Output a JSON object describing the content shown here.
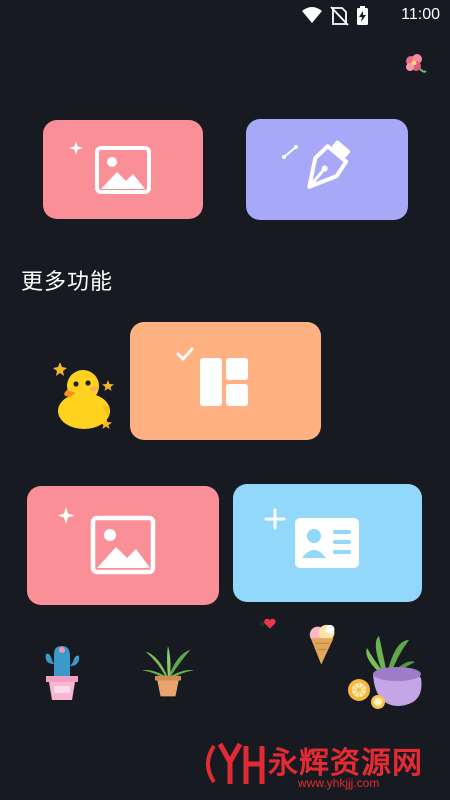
{
  "status_bar": {
    "time": "11:00",
    "icons": [
      "wifi-icon",
      "no-sim-icon",
      "battery-charging-icon"
    ]
  },
  "header": {
    "decoration": "flower-icon"
  },
  "top_cards": [
    {
      "icon": "image-sparkle-icon",
      "color": "#fb8f98"
    },
    {
      "icon": "pen-tool-icon",
      "color": "#a7a8f7"
    }
  ],
  "section": {
    "title": "更多功能"
  },
  "more_cards": [
    {
      "icon": "layout-check-icon",
      "color": "#ffb182"
    },
    {
      "icon": "image-sparkle-icon",
      "color": "#fb8f98"
    },
    {
      "icon": "id-card-plus-icon",
      "color": "#91d8fb"
    }
  ],
  "decorations": [
    "duck-sticker",
    "cactus-pot",
    "plant-pot",
    "heart-icon",
    "ice-cream-cone",
    "plant-bowl-oranges"
  ],
  "watermark": {
    "title": "永辉资源网",
    "url": "www.yhkjjj.com"
  }
}
